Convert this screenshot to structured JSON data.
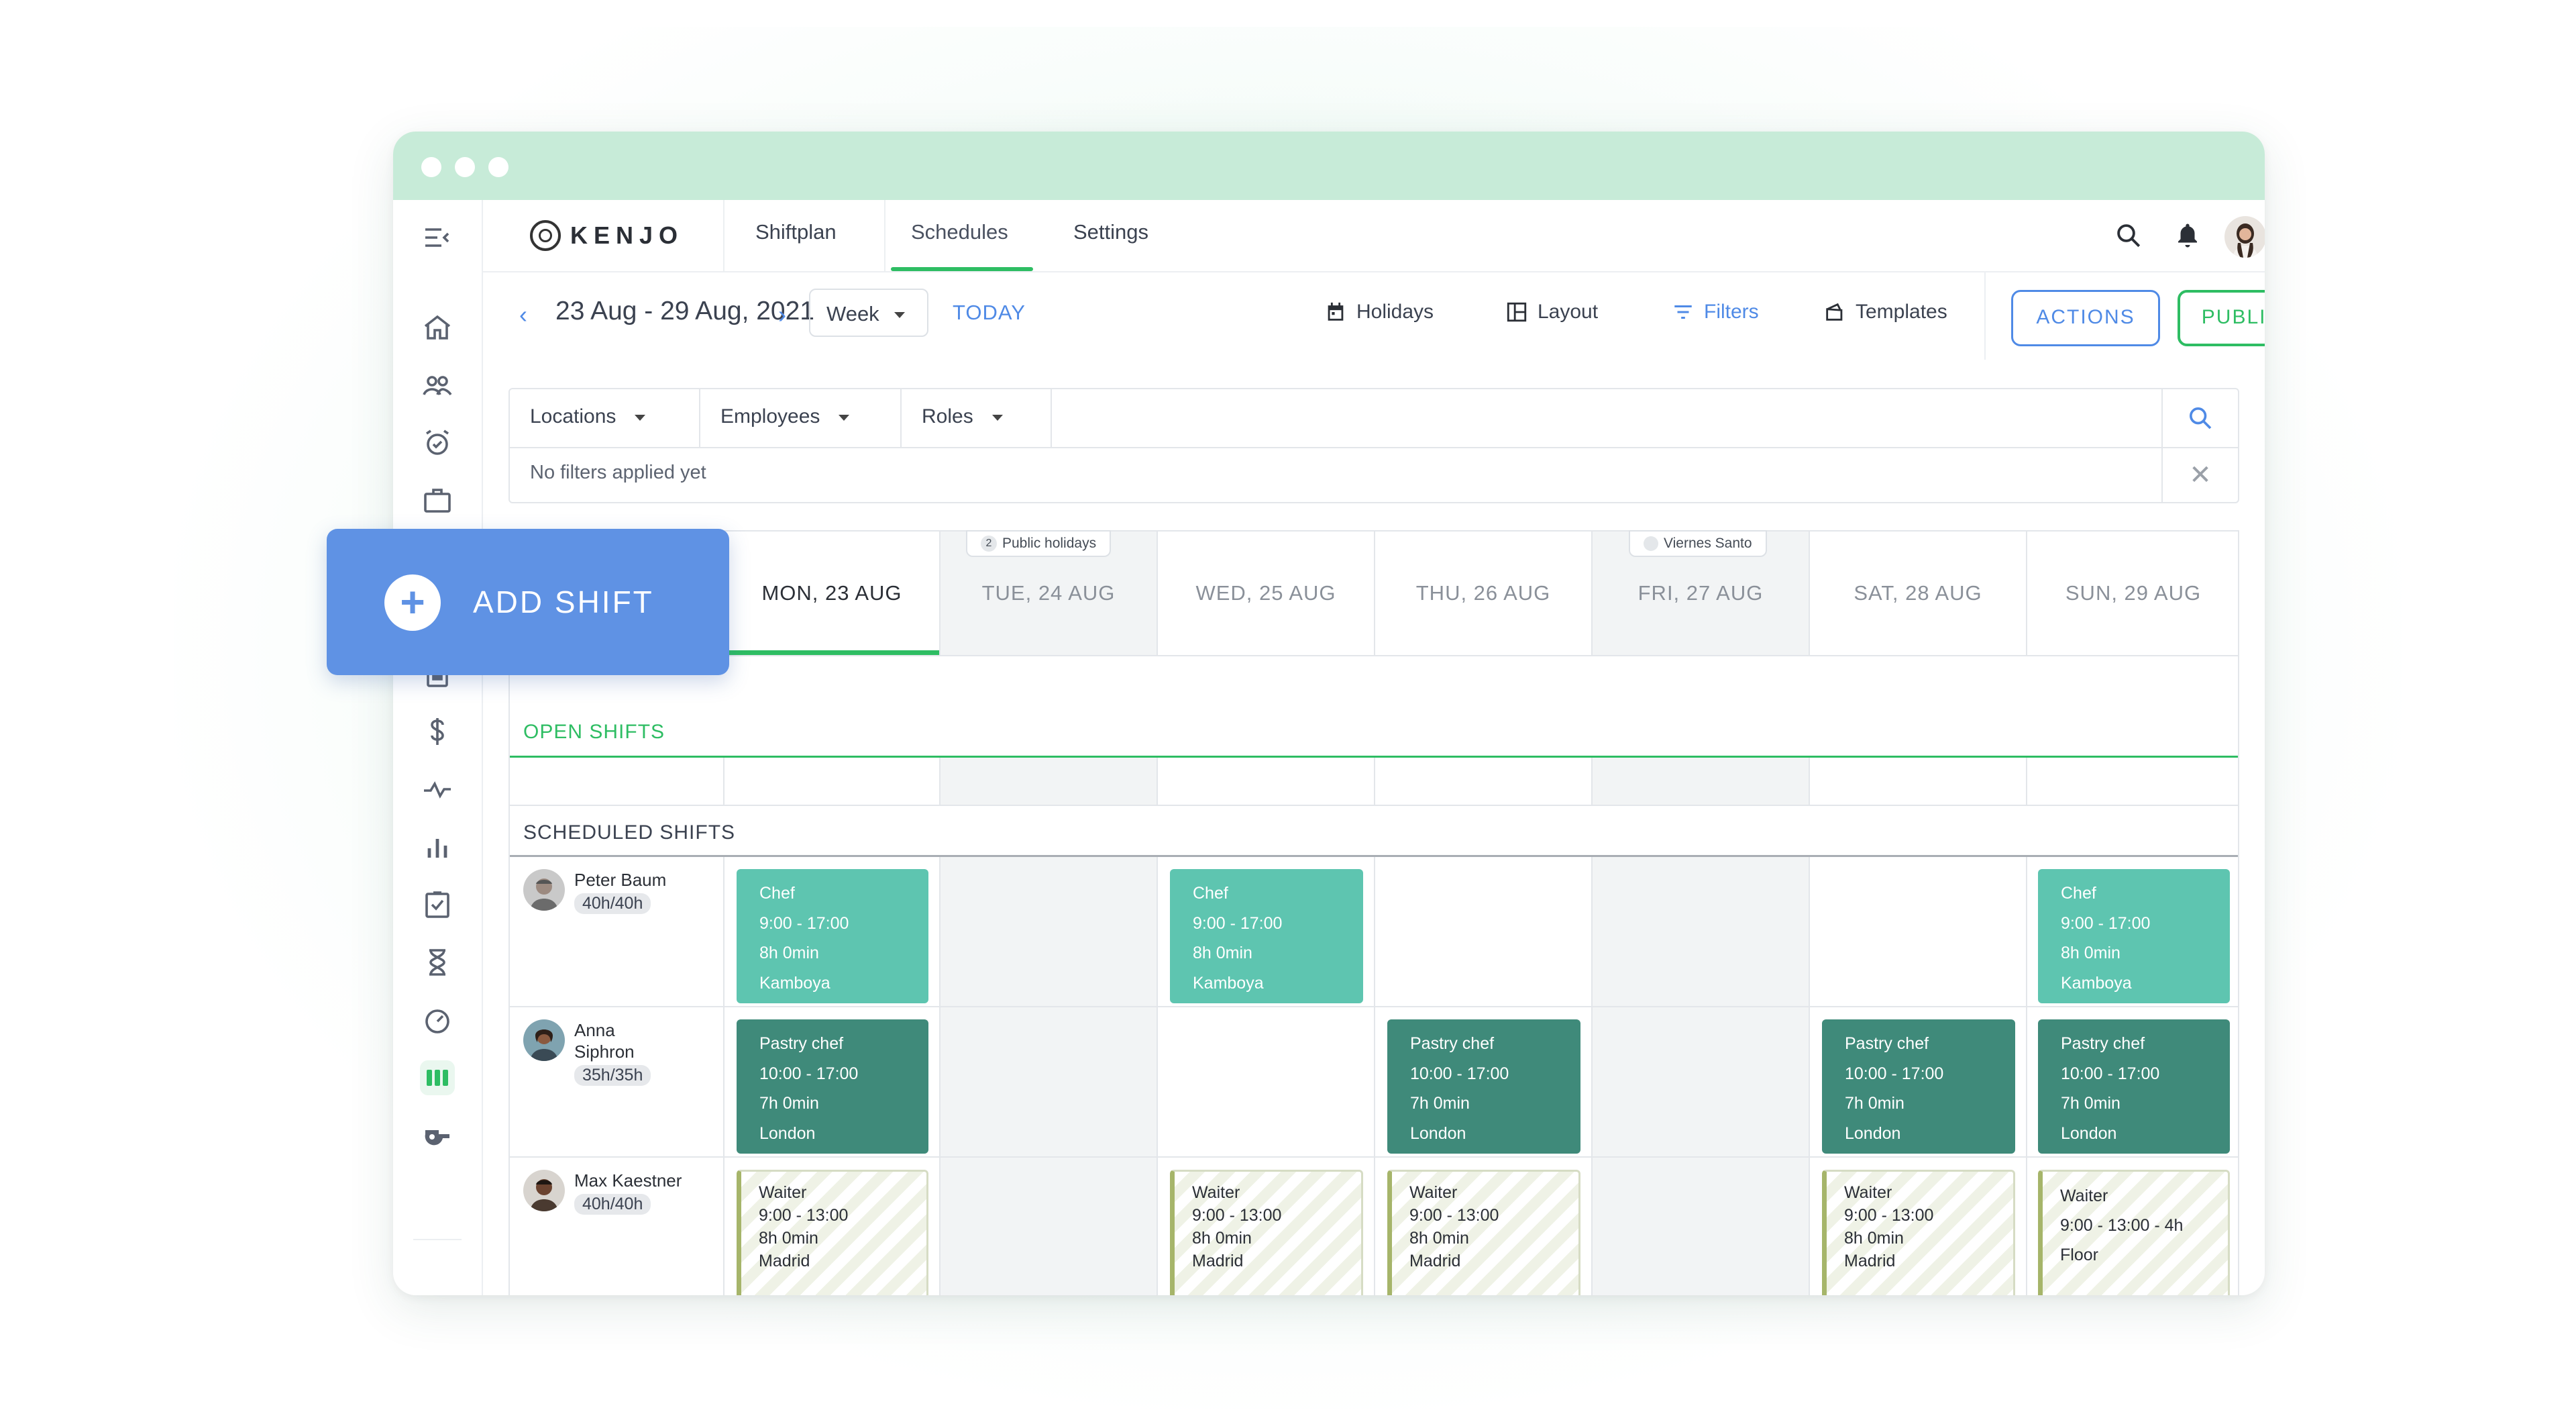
{
  "nav": {
    "logo": "KENJO",
    "tabs": [
      {
        "label": "Shiftplan"
      },
      {
        "label": "Schedules"
      },
      {
        "label": "Settings"
      }
    ]
  },
  "toolbar": {
    "date_range": "23 Aug - 29 Aug, 2021",
    "view": "Week",
    "today": "TODAY",
    "holidays": "Holidays",
    "layout": "Layout",
    "filters": "Filters",
    "templates": "Templates",
    "actions": "ACTIONS",
    "publish": "PUBLISH"
  },
  "filters": {
    "locations": "Locations",
    "employees": "Employees",
    "roles": "Roles",
    "note": "No filters applied yet"
  },
  "calendar": {
    "days": [
      {
        "label": "MON, 23 AUG"
      },
      {
        "label": "TUE, 24 AUG",
        "badge": "Public holidays",
        "badge_count": "2"
      },
      {
        "label": "WED, 25 AUG"
      },
      {
        "label": "THU, 26 AUG"
      },
      {
        "label": "FRI, 27 AUG",
        "badge": "Viernes Santo"
      },
      {
        "label": "SAT, 28 AUG"
      },
      {
        "label": "SUN, 29 AUG"
      }
    ],
    "open_shifts_label": "OPEN SHIFTS",
    "scheduled_shifts_label": "SCHEDULED SHIFTS",
    "employees": [
      {
        "name": "Peter Baum",
        "hours": "40h/40h"
      },
      {
        "name": "Anna Siphron",
        "hours": "35h/35h"
      },
      {
        "name": "Max Kaestner",
        "hours": "40h/40h"
      }
    ],
    "shifts": {
      "chef": {
        "role": "Chef",
        "time": "9:00 - 17:00",
        "duration": "8h 0min",
        "location": "Kamboya"
      },
      "pastry": {
        "role": "Pastry chef",
        "time": "10:00 - 17:00",
        "duration": "7h 0min",
        "location": "London"
      },
      "waiter": {
        "role": "Waiter",
        "time": "9:00 - 13:00",
        "duration": "8h 0min",
        "location": "Madrid"
      },
      "waiter_sun": {
        "role": "Waiter",
        "time": "9:00 - 13:00 - 4h",
        "location": "Floor"
      }
    }
  },
  "add_shift": {
    "label": "ADD SHIFT"
  },
  "colors": {
    "accent_blue": "#4f8ae6",
    "accent_green": "#2ebd63",
    "chef_shift": "#5ec5b0",
    "pastry_shift": "#3f8a7a",
    "titlebar": "#c7ebd8"
  }
}
